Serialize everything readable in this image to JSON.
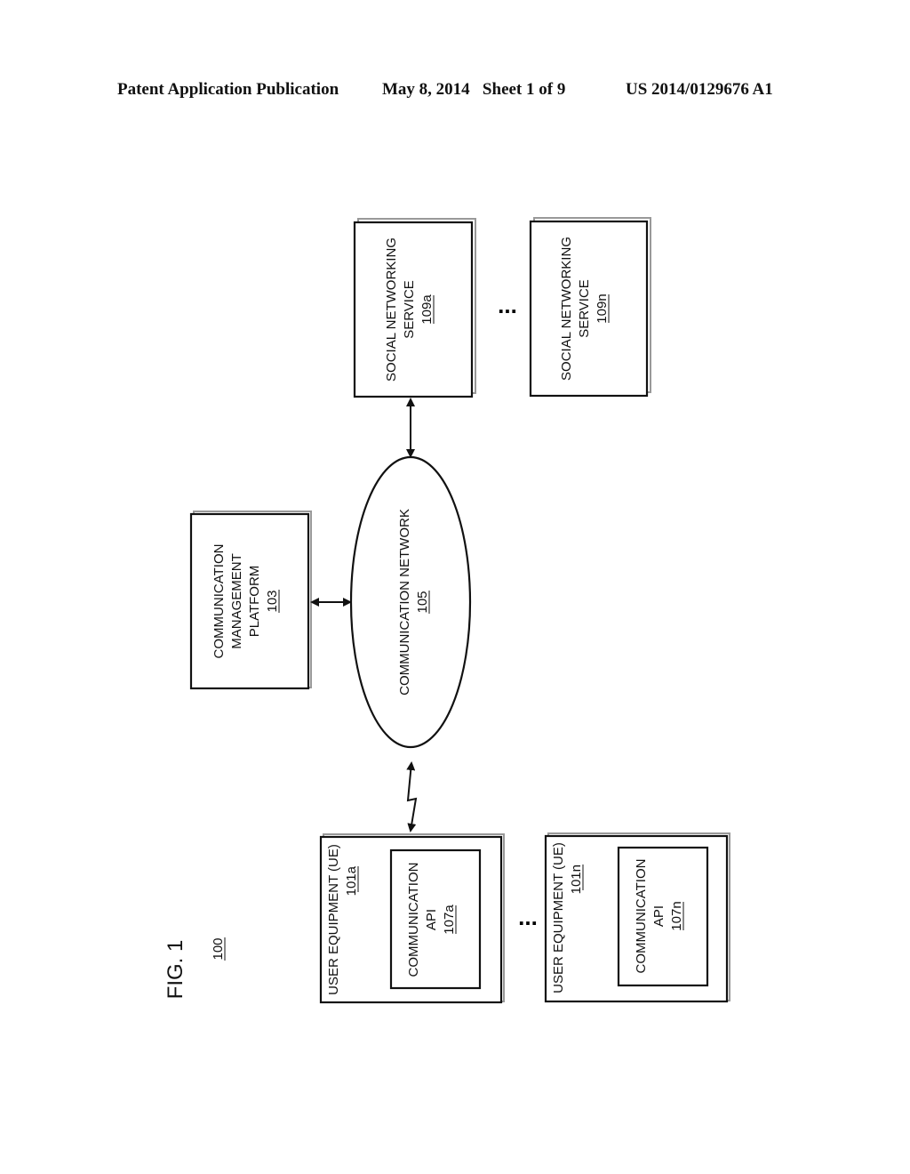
{
  "header": {
    "publication": "Patent Application Publication",
    "date_sheet": "May 8, 2014   Sheet 1 of 9",
    "number": "US 2014/0129676 A1"
  },
  "figure": {
    "title": "FIG. 1",
    "ref": "100",
    "ellipsis": "..."
  },
  "nodes": {
    "sns_a": {
      "line1": "SOCIAL NETWORKING",
      "line2": "SERVICE",
      "ref": "109a"
    },
    "sns_n": {
      "line1": "SOCIAL NETWORKING",
      "line2": "SERVICE",
      "ref": "109n"
    },
    "platform": {
      "line1": "COMMUNICATION",
      "line2": "MANAGEMENT",
      "line3": "PLATFORM",
      "ref": "103"
    },
    "network": {
      "line1": "COMMUNICATION NETWORK",
      "ref": "105"
    },
    "ue_a": {
      "line1": "USER EQUIPMENT (UE)",
      "ref": "101a",
      "api_line1": "COMMUNICATION",
      "api_line2": "API",
      "api_ref": "107a"
    },
    "ue_n": {
      "line1": "USER EQUIPMENT (UE)",
      "ref": "101n",
      "api_line1": "COMMUNICATION",
      "api_line2": "API",
      "api_ref": "107n"
    }
  }
}
